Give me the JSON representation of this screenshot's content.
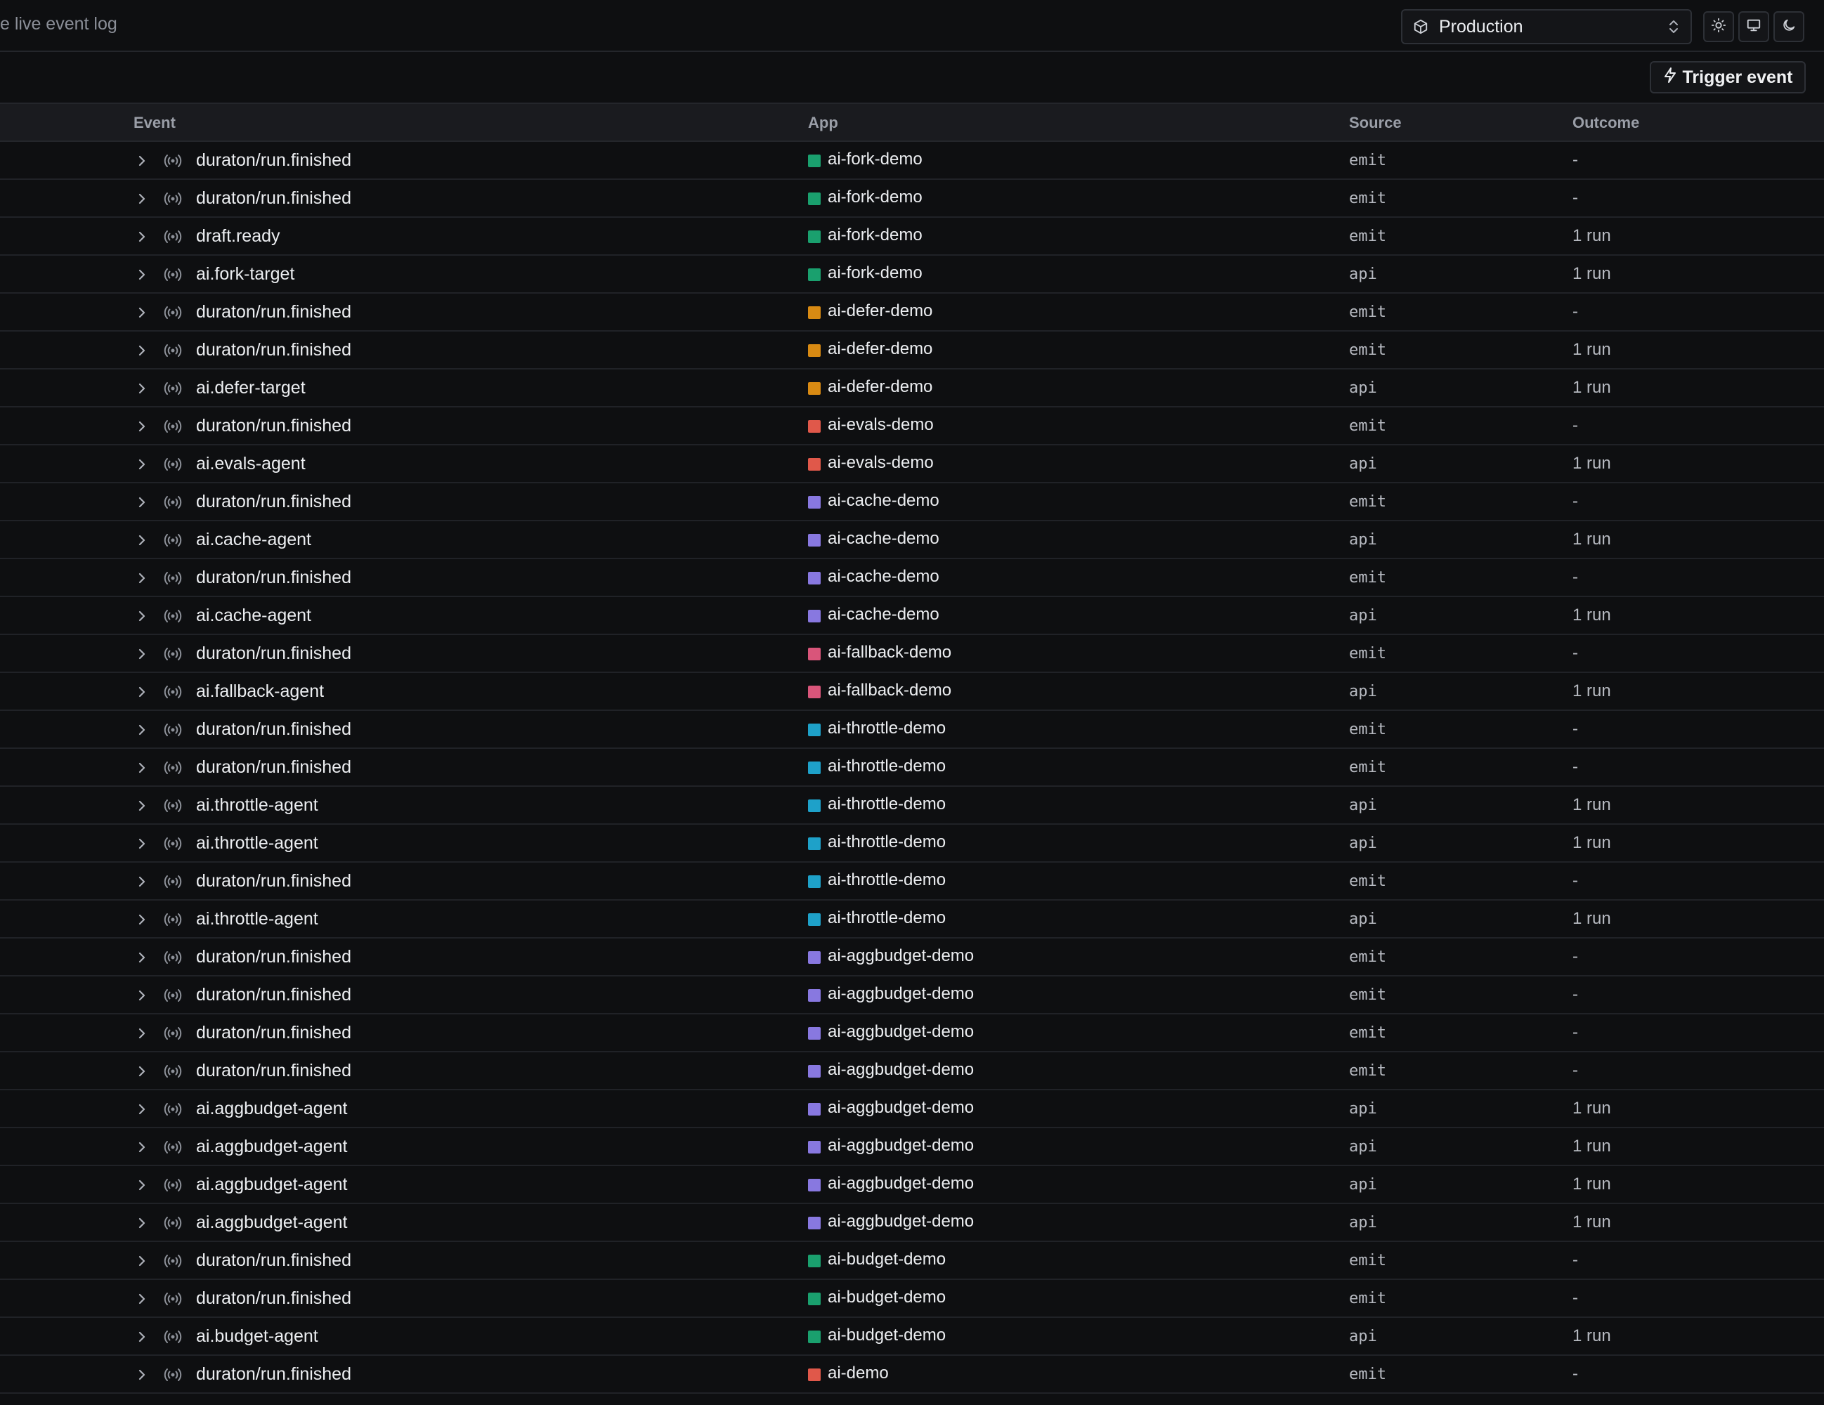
{
  "header": {
    "subtitle": "e live event log",
    "environment": "Production",
    "icons": {
      "environment": "cube-icon",
      "selector": "chevrons-up-down-icon",
      "light": "sun-icon",
      "system": "monitor-icon",
      "dark": "moon-icon"
    }
  },
  "toolbar": {
    "trigger_label": "Trigger event",
    "trigger_icon": "lightning-icon"
  },
  "table": {
    "columns": {
      "event": "Event",
      "app": "App",
      "source": "Source",
      "outcome": "Outcome"
    },
    "rows": [
      {
        "event": "duraton/run.finished",
        "app": "ai-fork-demo",
        "color": "#1aa06e",
        "source": "emit",
        "outcome": "-"
      },
      {
        "event": "duraton/run.finished",
        "app": "ai-fork-demo",
        "color": "#1aa06e",
        "source": "emit",
        "outcome": "-"
      },
      {
        "event": "draft.ready",
        "app": "ai-fork-demo",
        "color": "#1aa06e",
        "source": "emit",
        "outcome": "1 run"
      },
      {
        "event": "ai.fork-target",
        "app": "ai-fork-demo",
        "color": "#1aa06e",
        "source": "api",
        "outcome": "1 run"
      },
      {
        "event": "duraton/run.finished",
        "app": "ai-defer-demo",
        "color": "#d88a13",
        "source": "emit",
        "outcome": "-"
      },
      {
        "event": "duraton/run.finished",
        "app": "ai-defer-demo",
        "color": "#d88a13",
        "source": "emit",
        "outcome": "1 run"
      },
      {
        "event": "ai.defer-target",
        "app": "ai-defer-demo",
        "color": "#d88a13",
        "source": "api",
        "outcome": "1 run"
      },
      {
        "event": "duraton/run.finished",
        "app": "ai-evals-demo",
        "color": "#e0584a",
        "source": "emit",
        "outcome": "-"
      },
      {
        "event": "ai.evals-agent",
        "app": "ai-evals-demo",
        "color": "#e0584a",
        "source": "api",
        "outcome": "1 run"
      },
      {
        "event": "duraton/run.finished",
        "app": "ai-cache-demo",
        "color": "#8878e0",
        "source": "emit",
        "outcome": "-"
      },
      {
        "event": "ai.cache-agent",
        "app": "ai-cache-demo",
        "color": "#8878e0",
        "source": "api",
        "outcome": "1 run"
      },
      {
        "event": "duraton/run.finished",
        "app": "ai-cache-demo",
        "color": "#8878e0",
        "source": "emit",
        "outcome": "-"
      },
      {
        "event": "ai.cache-agent",
        "app": "ai-cache-demo",
        "color": "#8878e0",
        "source": "api",
        "outcome": "1 run"
      },
      {
        "event": "duraton/run.finished",
        "app": "ai-fallback-demo",
        "color": "#d9557a",
        "source": "emit",
        "outcome": "-"
      },
      {
        "event": "ai.fallback-agent",
        "app": "ai-fallback-demo",
        "color": "#d9557a",
        "source": "api",
        "outcome": "1 run"
      },
      {
        "event": "duraton/run.finished",
        "app": "ai-throttle-demo",
        "color": "#1ea1c9",
        "source": "emit",
        "outcome": "-"
      },
      {
        "event": "duraton/run.finished",
        "app": "ai-throttle-demo",
        "color": "#1ea1c9",
        "source": "emit",
        "outcome": "-"
      },
      {
        "event": "ai.throttle-agent",
        "app": "ai-throttle-demo",
        "color": "#1ea1c9",
        "source": "api",
        "outcome": "1 run"
      },
      {
        "event": "ai.throttle-agent",
        "app": "ai-throttle-demo",
        "color": "#1ea1c9",
        "source": "api",
        "outcome": "1 run"
      },
      {
        "event": "duraton/run.finished",
        "app": "ai-throttle-demo",
        "color": "#1ea1c9",
        "source": "emit",
        "outcome": "-"
      },
      {
        "event": "ai.throttle-agent",
        "app": "ai-throttle-demo",
        "color": "#1ea1c9",
        "source": "api",
        "outcome": "1 run"
      },
      {
        "event": "duraton/run.finished",
        "app": "ai-aggbudget-demo",
        "color": "#8878e0",
        "source": "emit",
        "outcome": "-"
      },
      {
        "event": "duraton/run.finished",
        "app": "ai-aggbudget-demo",
        "color": "#8878e0",
        "source": "emit",
        "outcome": "-"
      },
      {
        "event": "duraton/run.finished",
        "app": "ai-aggbudget-demo",
        "color": "#8878e0",
        "source": "emit",
        "outcome": "-"
      },
      {
        "event": "duraton/run.finished",
        "app": "ai-aggbudget-demo",
        "color": "#8878e0",
        "source": "emit",
        "outcome": "-"
      },
      {
        "event": "ai.aggbudget-agent",
        "app": "ai-aggbudget-demo",
        "color": "#8878e0",
        "source": "api",
        "outcome": "1 run"
      },
      {
        "event": "ai.aggbudget-agent",
        "app": "ai-aggbudget-demo",
        "color": "#8878e0",
        "source": "api",
        "outcome": "1 run"
      },
      {
        "event": "ai.aggbudget-agent",
        "app": "ai-aggbudget-demo",
        "color": "#8878e0",
        "source": "api",
        "outcome": "1 run"
      },
      {
        "event": "ai.aggbudget-agent",
        "app": "ai-aggbudget-demo",
        "color": "#8878e0",
        "source": "api",
        "outcome": "1 run"
      },
      {
        "event": "duraton/run.finished",
        "app": "ai-budget-demo",
        "color": "#1aa06e",
        "source": "emit",
        "outcome": "-"
      },
      {
        "event": "duraton/run.finished",
        "app": "ai-budget-demo",
        "color": "#1aa06e",
        "source": "emit",
        "outcome": "-"
      },
      {
        "event": "ai.budget-agent",
        "app": "ai-budget-demo",
        "color": "#1aa06e",
        "source": "api",
        "outcome": "1 run"
      },
      {
        "event": "duraton/run.finished",
        "app": "ai-demo",
        "color": "#e0584a",
        "source": "emit",
        "outcome": "-"
      }
    ]
  }
}
